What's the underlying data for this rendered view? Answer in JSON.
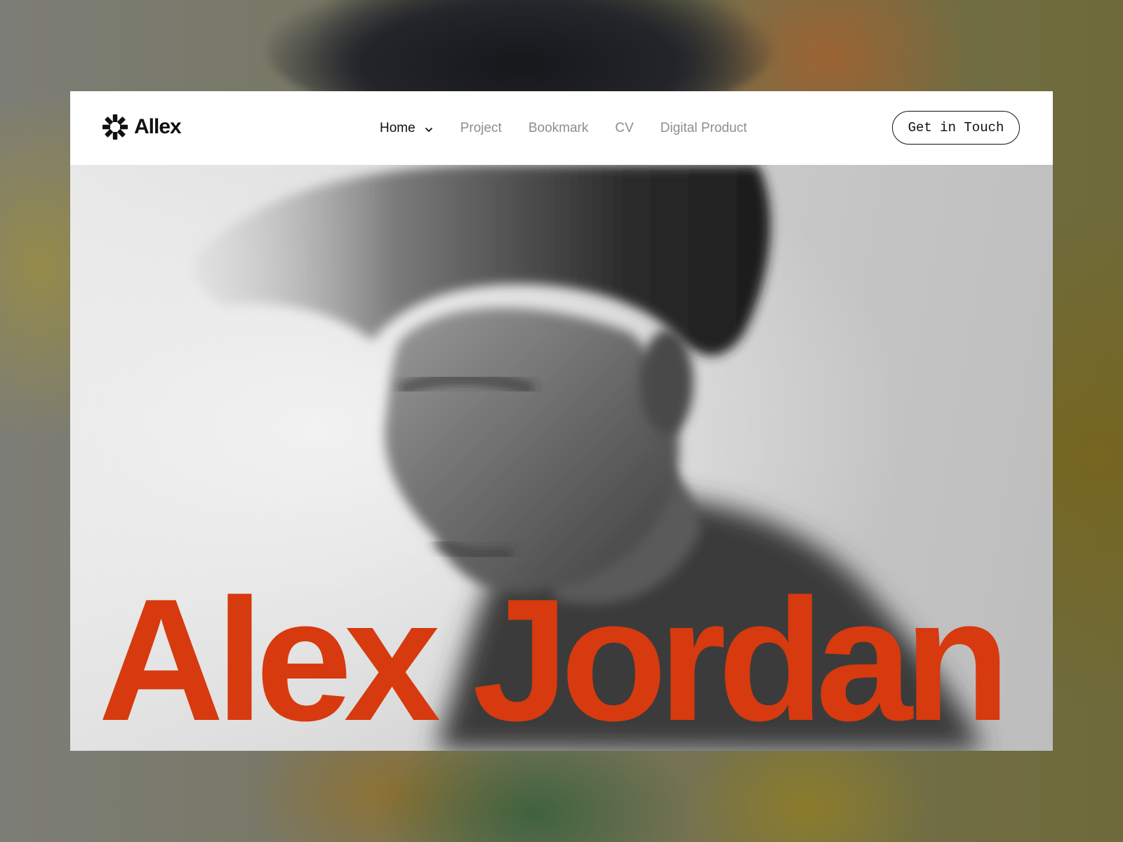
{
  "brand": {
    "name": "Allex",
    "logo_icon": "asterisk-burst-icon"
  },
  "nav": {
    "items": [
      {
        "label": "Home",
        "active": true,
        "has_dropdown": true
      },
      {
        "label": "Project",
        "active": false
      },
      {
        "label": "Bookmark",
        "active": false
      },
      {
        "label": "CV",
        "active": false
      },
      {
        "label": "Digital Product",
        "active": false
      }
    ]
  },
  "cta": {
    "label": "Get in Touch"
  },
  "hero": {
    "name": "Alex Jordan",
    "photo": "black-and-white portrait photo",
    "name_color": "#d63a0e"
  },
  "colors": {
    "accent": "#d63a0e",
    "text_primary": "#111111",
    "text_muted": "#8e8e8e",
    "nav_background": "#ffffff"
  }
}
